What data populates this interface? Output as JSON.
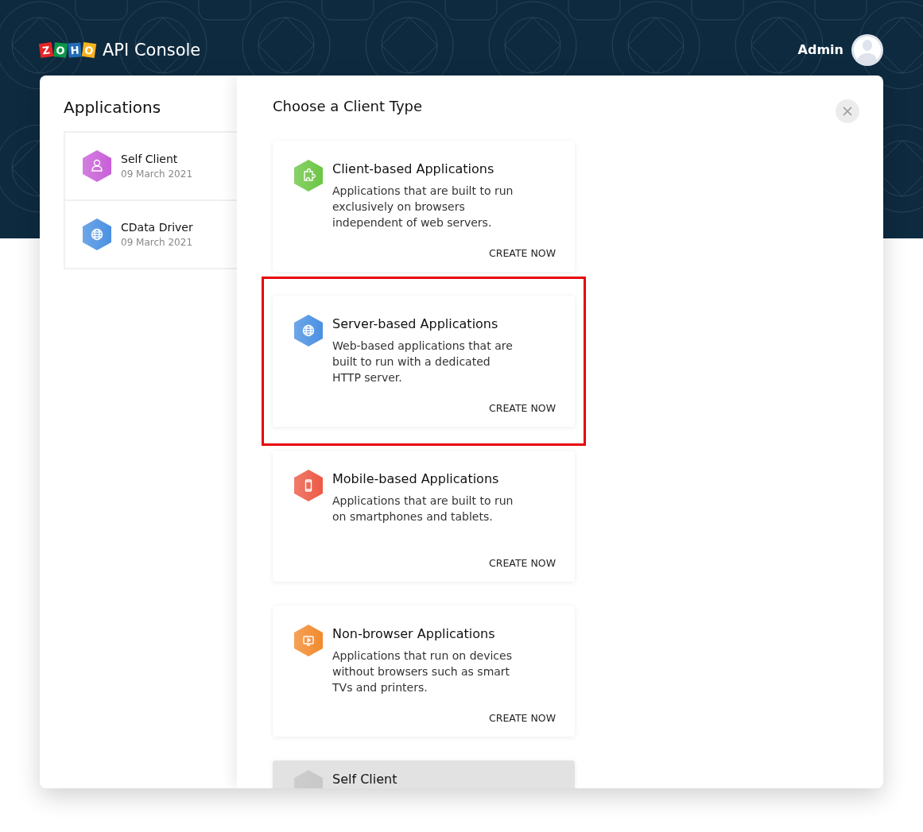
{
  "header": {
    "logo_letters": [
      {
        "letter": "Z",
        "color": "#e42527"
      },
      {
        "letter": "O",
        "color": "#089949"
      },
      {
        "letter": "H",
        "color": "#226db4"
      },
      {
        "letter": "O",
        "color": "#f9b21d"
      }
    ],
    "title": "API Console",
    "user": "Admin"
  },
  "applications": {
    "title": "Applications",
    "items": [
      {
        "kind": "self",
        "name": "Self Client",
        "date": "09 March 2021",
        "color": "#c85fd8"
      },
      {
        "kind": "server",
        "name": "CData Driver",
        "date": "09 March 2021",
        "color": "#4a90e2"
      }
    ]
  },
  "client_types": {
    "title": "Choose a Client Type",
    "cards": [
      {
        "kind": "client",
        "title": "Client-based Applications",
        "description": "Applications that are built to run exclusively on browsers independent of web servers.",
        "action": "CREATE NOW",
        "color": "#6cc644",
        "highlighted": false
      },
      {
        "kind": "server",
        "title": "Server-based Applications",
        "description": "Web-based applications that are built to run with a dedicated HTTP server.",
        "action": "CREATE NOW",
        "color": "#4a90e2",
        "highlighted": true
      },
      {
        "kind": "mobile",
        "title": "Mobile-based Applications",
        "description": "Applications that are built to run on smartphones and tablets.",
        "action": "CREATE NOW",
        "color": "#ec5a45",
        "highlighted": false
      },
      {
        "kind": "nonbrowser",
        "title": "Non-browser Applications",
        "description": "Applications that run on devices without browsers such as smart TVs and printers.",
        "action": "CREATE NOW",
        "color": "#f28a2e",
        "highlighted": false
      },
      {
        "kind": "selfclient",
        "title": "Self Client",
        "color": "#c8c8c8",
        "highlighted": false
      }
    ]
  }
}
